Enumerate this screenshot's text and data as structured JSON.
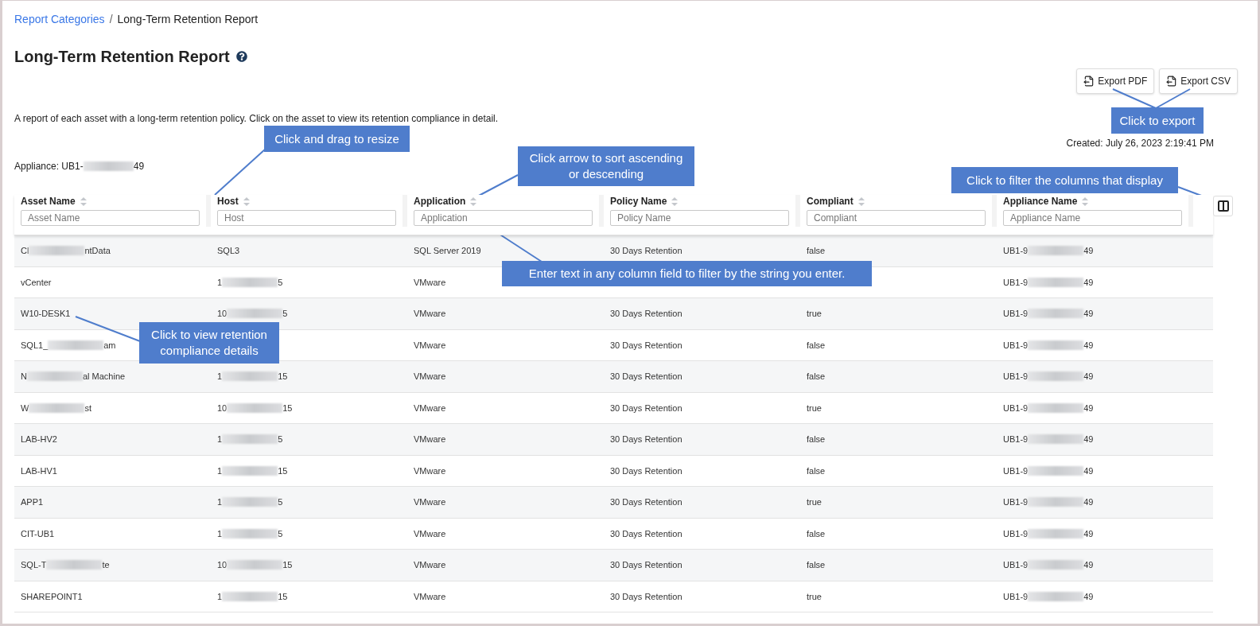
{
  "breadcrumb_separator": "/",
  "breadcrumb": [
    {
      "label": "Report Categories",
      "kind": "link"
    },
    {
      "label": "Long-Term Retention Report",
      "kind": "current"
    }
  ],
  "title": "Long-Term Retention Report",
  "export_buttons": [
    "Export PDF",
    "Export CSV"
  ],
  "description": "A report of each asset with a long-term retention policy. Click on the asset to view its retention compliance in detail.",
  "created": "Created: July 26, 2023 2:19:41 PM",
  "appliance": {
    "head": "Appliance: UB1-",
    "tail": "49"
  },
  "table": {
    "columns": [
      {
        "label": "Asset Name",
        "placeholder": "Asset Name"
      },
      {
        "label": "Host",
        "placeholder": "Host"
      },
      {
        "label": "Application",
        "placeholder": "Application"
      },
      {
        "label": "Policy Name",
        "placeholder": "Policy Name"
      },
      {
        "label": "Compliant",
        "placeholder": "Compliant"
      },
      {
        "label": "Appliance Name",
        "placeholder": "Appliance Name"
      }
    ],
    "rows": [
      [
        {
          "head": "Cl",
          "tail": "ntData"
        },
        "SQL3",
        "SQL Server 2019",
        "30 Days Retention",
        "false",
        {
          "head": "UB1-9",
          "tail": "49"
        }
      ],
      [
        "vCenter",
        {
          "head": "1",
          "tail": "5"
        },
        "VMware",
        null,
        null,
        {
          "head": "UB1-9",
          "tail": "49"
        }
      ],
      [
        "W10-DESK1",
        {
          "head": "10",
          "tail": "5"
        },
        "VMware",
        "30 Days Retention",
        "true",
        {
          "head": "UB1-9",
          "tail": "49"
        }
      ],
      [
        {
          "head": "SQL1_",
          "tail": "am"
        },
        null,
        "VMware",
        "30 Days Retention",
        "false",
        {
          "head": "UB1-9",
          "tail": "49"
        }
      ],
      [
        {
          "head": "N",
          "tail": "al Machine"
        },
        {
          "head": "1",
          "tail": "15"
        },
        "VMware",
        "30 Days Retention",
        "false",
        {
          "head": "UB1-9",
          "tail": "49"
        }
      ],
      [
        {
          "head": "W",
          "tail": "st"
        },
        {
          "head": "10",
          "tail": "15"
        },
        "VMware",
        "30 Days Retention",
        "true",
        {
          "head": "UB1-9",
          "tail": "49"
        }
      ],
      [
        "LAB-HV2",
        {
          "head": "1",
          "tail": "5"
        },
        "VMware",
        "30 Days Retention",
        "false",
        {
          "head": "UB1-9",
          "tail": "49"
        }
      ],
      [
        "LAB-HV1",
        {
          "head": "1",
          "tail": "15"
        },
        "VMware",
        "30 Days Retention",
        "false",
        {
          "head": "UB1-9",
          "tail": "49"
        }
      ],
      [
        "APP1",
        {
          "head": "1",
          "tail": "5"
        },
        "VMware",
        "30 Days Retention",
        "true",
        {
          "head": "UB1-9",
          "tail": "49"
        }
      ],
      [
        "CIT-UB1",
        {
          "head": "1",
          "tail": "5"
        },
        "VMware",
        "30 Days Retention",
        "false",
        {
          "head": "UB1-9",
          "tail": "49"
        }
      ],
      [
        {
          "head": "SQL-T",
          "tail": "te"
        },
        {
          "head": "10",
          "tail": "15"
        },
        "VMware",
        "30 Days Retention",
        "false",
        {
          "head": "UB1-9",
          "tail": "49"
        }
      ],
      [
        "SHAREPOINT1",
        {
          "head": "1",
          "tail": "15"
        },
        "VMware",
        "30 Days Retention",
        "true",
        {
          "head": "UB1-9",
          "tail": "49"
        }
      ]
    ]
  },
  "callouts": [
    "Click and drag to resize",
    "Click arrow to sort ascending or descending",
    "Click to export",
    "Click to filter the columns that display",
    "Enter text in any column field to filter by the string you enter.",
    "Click to view retention compliance details"
  ]
}
